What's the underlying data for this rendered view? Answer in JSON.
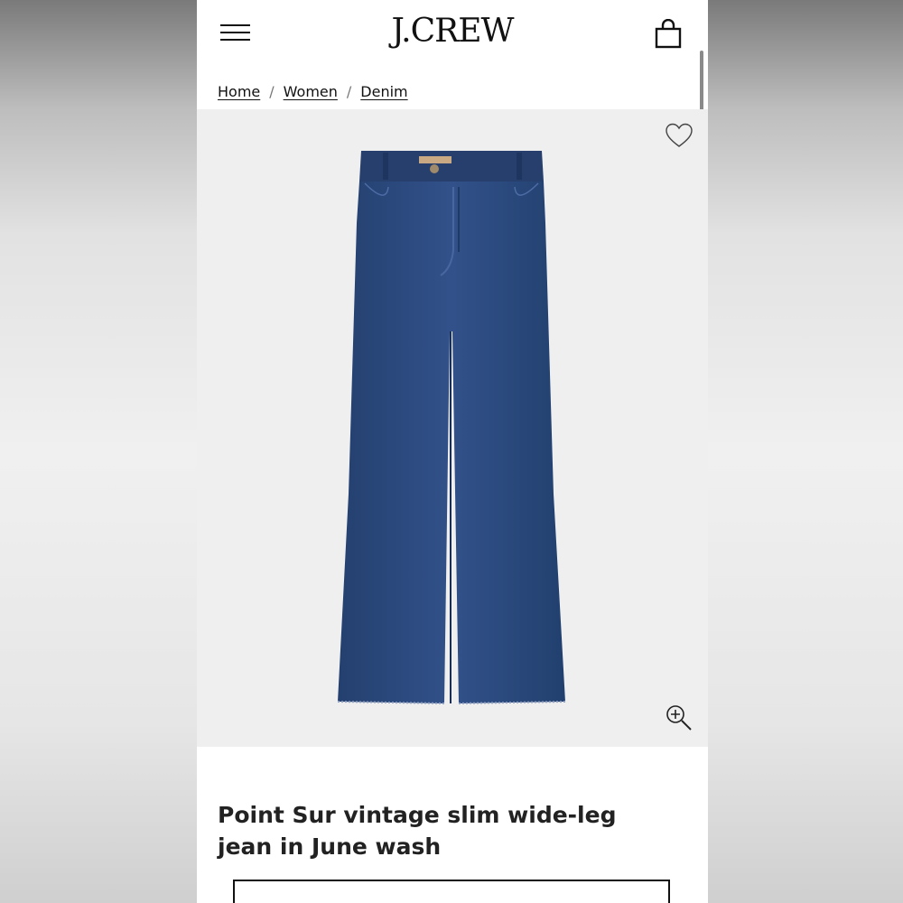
{
  "brand": {
    "logo": "J.CREW"
  },
  "header": {
    "menu_icon": "hamburger-menu-icon",
    "bag_icon": "shopping-bag-icon"
  },
  "breadcrumb": {
    "items": [
      {
        "label": "Home"
      },
      {
        "label": "Women"
      },
      {
        "label": "Denim"
      }
    ],
    "separator": "/"
  },
  "product": {
    "title": "Point Sur vintage slim wide-leg jean in June wash",
    "image_icon_wishlist": "heart-icon",
    "image_icon_zoom": "zoom-in-icon",
    "denim_color": "#2d4a7e"
  },
  "colors": {
    "image_background": "#efefef",
    "text": "#111111"
  }
}
